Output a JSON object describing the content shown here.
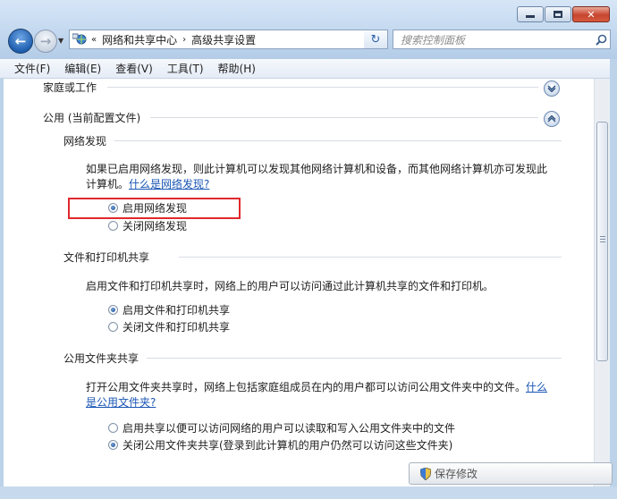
{
  "window": {
    "controls": {
      "minimize_icon": "minimize-icon",
      "maximize_icon": "maximize-icon",
      "close_icon": "close-icon"
    }
  },
  "navigation": {
    "address_prefix": "«",
    "breadcrumbs": [
      "网络和共享中心",
      "高级共享设置"
    ],
    "breadcrumb_separator": "›",
    "search_placeholder": "搜索控制面板"
  },
  "menu": [
    "文件(F)",
    "编辑(E)",
    "查看(V)",
    "工具(T)",
    "帮助(H)"
  ],
  "profiles": {
    "home_work": {
      "label": "家庭或工作",
      "expanded": false
    },
    "public": {
      "label": "公用 (当前配置文件)",
      "expanded": true
    }
  },
  "network_discovery": {
    "heading": "网络发现",
    "desc_line1": "如果已启用网络发现，则此计算机可以发现其他网络计算机和设备，而其他网络计算机亦可发现此",
    "desc_line2": "计算机。",
    "link": "什么是网络发现?",
    "options": [
      {
        "label": "启用网络发现",
        "selected": true
      },
      {
        "label": "关闭网络发现",
        "selected": false
      }
    ],
    "highlight_color": "#e0282d"
  },
  "file_printer_sharing": {
    "heading": "文件和打印机共享",
    "desc": "启用文件和打印机共享时，网络上的用户可以访问通过此计算机共享的文件和打印机。",
    "options": [
      {
        "label": "启用文件和打印机共享",
        "selected": true
      },
      {
        "label": "关闭文件和打印机共享",
        "selected": false
      }
    ]
  },
  "public_folder_sharing": {
    "heading": "公用文件夹共享",
    "desc_line1": "打开公用文件夹共享时，网络上包括家庭组成员在内的用户都可以访问公用文件夹中的文件。",
    "link_part1": "什么",
    "link_part2": "是公用文件夹?",
    "options": [
      {
        "label": "启用共享以便可以访问网络的用户可以读取和写入公用文件夹中的文件",
        "selected": false
      },
      {
        "label": "关闭公用文件夹共享(登录到此计算机的用户仍然可以访问这些文件夹)",
        "selected": true
      }
    ]
  },
  "footer": {
    "save_label": "保存修改"
  },
  "colors": {
    "link": "#1a56b4",
    "accent": "#1d4f98"
  }
}
